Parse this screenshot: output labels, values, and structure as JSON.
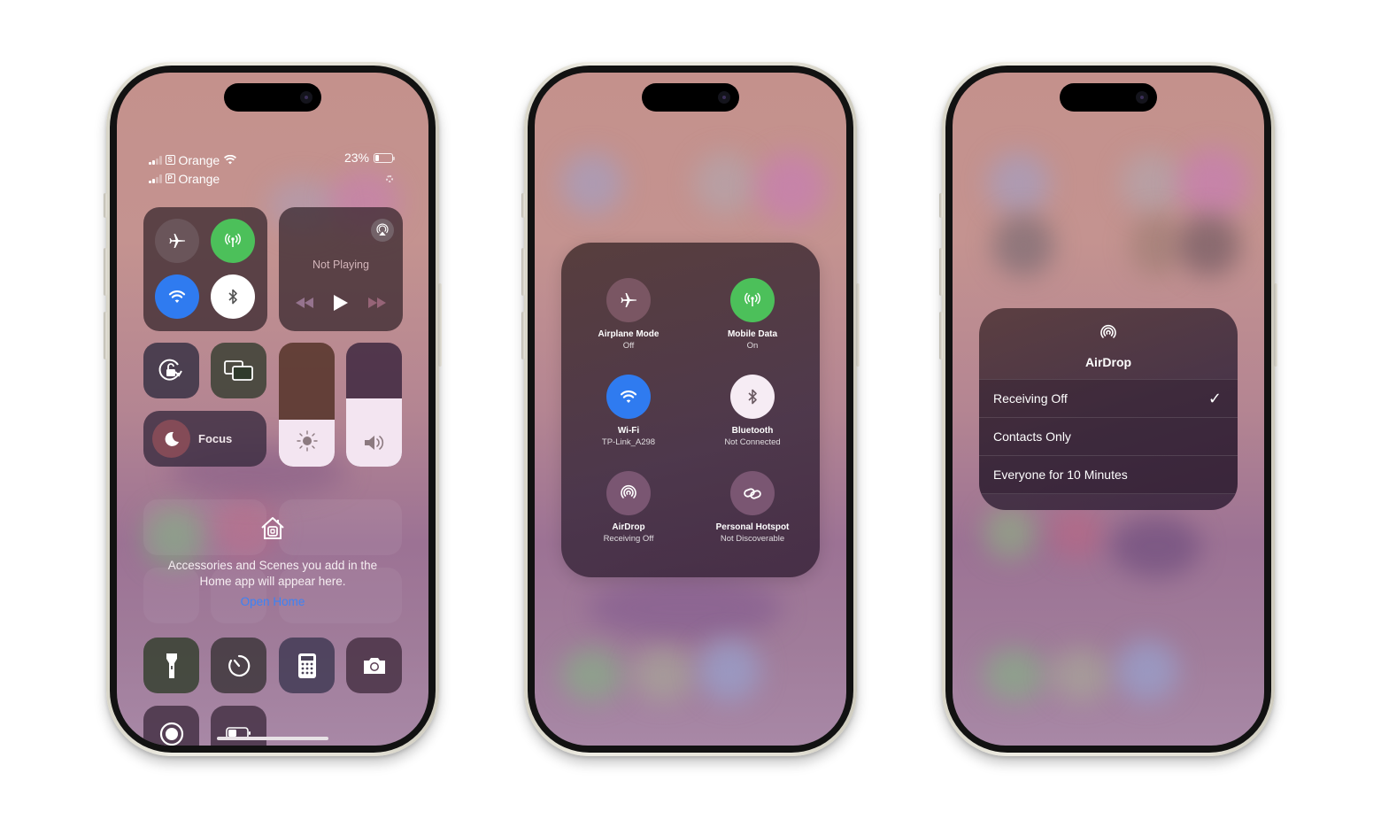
{
  "phones": [
    {
      "id": "control-center",
      "status_bar": {
        "carrier_1": {
          "sim_badge": "S",
          "name": "Orange"
        },
        "carrier_2": {
          "sim_badge": "P",
          "name": "Orange"
        },
        "battery_percent": "23%",
        "battery_level": 0.23
      },
      "connectivity": {
        "airplane_mode": {
          "state": "off",
          "icon": "airplane-icon"
        },
        "mobile_data": {
          "state": "on",
          "icon": "antenna-icon",
          "color": "#4cc05a"
        },
        "wifi": {
          "state": "on",
          "icon": "wifi-icon",
          "color": "#2f7bf0"
        },
        "bluetooth": {
          "state": "on",
          "icon": "bluetooth-icon",
          "color": "#ffffff"
        }
      },
      "now_playing": {
        "label": "Not Playing",
        "airplay_icon": "airplay-icon"
      },
      "controls": {
        "orientation_lock": "orientation-lock-icon",
        "screen_mirroring": "screen-mirroring-icon",
        "focus_label": "Focus",
        "brightness_level": 0.38,
        "volume_level": 0.55
      },
      "home": {
        "message": "Accessories and Scenes you add in the Home app will appear here.",
        "message_line1": "Accessories and Scenes you add in the",
        "message_line2": "Home app will appear here.",
        "link": "Open Home"
      },
      "shortcuts": [
        "flashlight",
        "timer",
        "calculator",
        "camera",
        "screen-recording",
        "low-power-mode"
      ]
    },
    {
      "id": "connectivity-expanded",
      "items": [
        {
          "label": "Airplane Mode",
          "status": "Off",
          "icon": "airplane-icon",
          "color": "#7a5663"
        },
        {
          "label": "Mobile Data",
          "status": "On",
          "icon": "antenna-icon",
          "color": "#4cc05a"
        },
        {
          "label": "Wi-Fi",
          "status": "TP-Link_A298",
          "icon": "wifi-icon",
          "color": "#2f7bf0"
        },
        {
          "label": "Bluetooth",
          "status": "Not Connected",
          "icon": "bluetooth-icon",
          "color": "#f6ecf4"
        },
        {
          "label": "AirDrop",
          "status": "Receiving Off",
          "icon": "airdrop-icon",
          "color": "#7a5672"
        },
        {
          "label": "Personal Hotspot",
          "status": "Not Discoverable",
          "icon": "hotspot-icon",
          "color": "#7a5672"
        }
      ]
    },
    {
      "id": "airdrop-menu",
      "title": "AirDrop",
      "options": [
        {
          "label": "Receiving Off",
          "selected": true
        },
        {
          "label": "Contacts Only",
          "selected": false
        },
        {
          "label": "Everyone for 10 Minutes",
          "selected": false
        }
      ],
      "check_glyph": "✓"
    }
  ]
}
